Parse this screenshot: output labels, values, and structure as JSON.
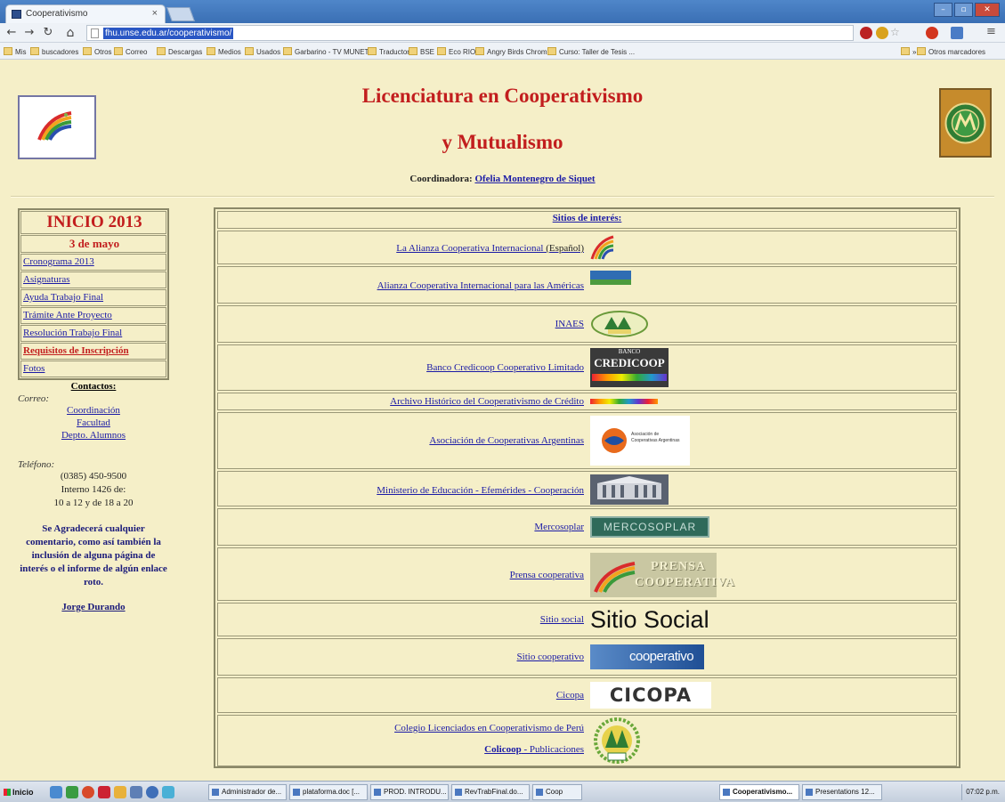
{
  "browser": {
    "tab_title": "Cooperativismo",
    "tab_close": "×",
    "url": "fhu.unse.edu.ar/cooperativismo/",
    "bookmarks": [
      "Mis",
      "buscadores",
      "Otros",
      "Correo",
      "Descargas",
      "Medios",
      "Usados",
      "Garbarino - TV MUNET...",
      "Traductor",
      "BSE",
      "Eco RIO",
      "Angry Birds Chrome",
      "Curso: Taller de Tesis ...",
      "»",
      "Otros marcadores"
    ]
  },
  "header": {
    "title_line1": "Licenciatura en Cooperativismo",
    "title_line2": "y Mutualismo",
    "coordinator_label": "Coordinadora:",
    "coordinator_name": "Ofelia Montenegro de Siquet"
  },
  "sidebar": {
    "heading": "INICIO 2013",
    "date": "3 de mayo",
    "items": [
      "Cronograma 2013",
      "Asignaturas",
      "Ayuda Trabajo Final",
      "Trámite Ante Proyecto",
      "Resolución Trabajo Final",
      "Requisitos de Inscripción",
      "Fotos"
    ],
    "contacts_title": "Contactos:",
    "mail_label": "Correo:",
    "mail_links": [
      "Coordinación",
      "Facultad",
      "Depto. Alumnos"
    ],
    "phone_label": "Teléfono:",
    "phone_lines": [
      "(0385) 450-9500",
      "Interno 1426 de:",
      "10 a 12 y de 18 a 20"
    ],
    "message": "Se Agradecerá cualquier comentario, como así también la inclusión de alguna página de interés o el informe de algún enlace roto.",
    "signature": "Jorge Durando"
  },
  "main": {
    "header": "Sitios de interés:",
    "links": [
      {
        "text": "La Alianza Cooperativa Internacional",
        "suffix": " (Español)"
      },
      {
        "text": "Alianza Cooperativa Internacional para las Américas"
      },
      {
        "text": "INAES"
      },
      {
        "text": "Banco Credicoop Cooperativo Limitado"
      },
      {
        "text": "Archivo Histórico del Cooperativismo de Crédito"
      },
      {
        "text": "Asociación de Cooperativas Argentinas"
      },
      {
        "text": "Ministerio de Educación - Efemérides - Cooperación"
      },
      {
        "text": "Mercosoplar"
      },
      {
        "text": "Prensa cooperativa"
      },
      {
        "text": "Sitio social"
      },
      {
        "text": "Sitio cooperativo"
      },
      {
        "text": "Cicopa"
      },
      {
        "text": "Colegio Licenciados en Cooperativismo de Perú",
        "sub_bold": "Colicoop",
        "sub_rest": " - Publicaciones"
      }
    ],
    "logo_texts": {
      "credicoop_small": "BANCO",
      "credicoop": "CREDICOOP",
      "aca": "Asociación de Cooperativas Argentinas",
      "mercosoplar": "MERCOSOPLAR",
      "prensa1": "PRENSA",
      "prensa2": "COOPERATIVA",
      "sitio_social": "Sitio Social",
      "cooperativo": "cooperativo",
      "cicopa": "CICOPA",
      "inaes": "INAES"
    }
  },
  "taskbar": {
    "start": "Inicio",
    "items": [
      "Administrador de...",
      "plataforma.doc [...",
      "PROD. INTRODU...",
      "RevTrabFinal.do...",
      "Coop",
      "Cooperativismo...",
      "Presentations 12..."
    ],
    "clock": "07:02 p.m."
  },
  "colors": {
    "page_bg": "#f5efc8",
    "title_red": "#c21e1e",
    "link_blue": "#1a1aa6",
    "border": "#8b8868"
  }
}
